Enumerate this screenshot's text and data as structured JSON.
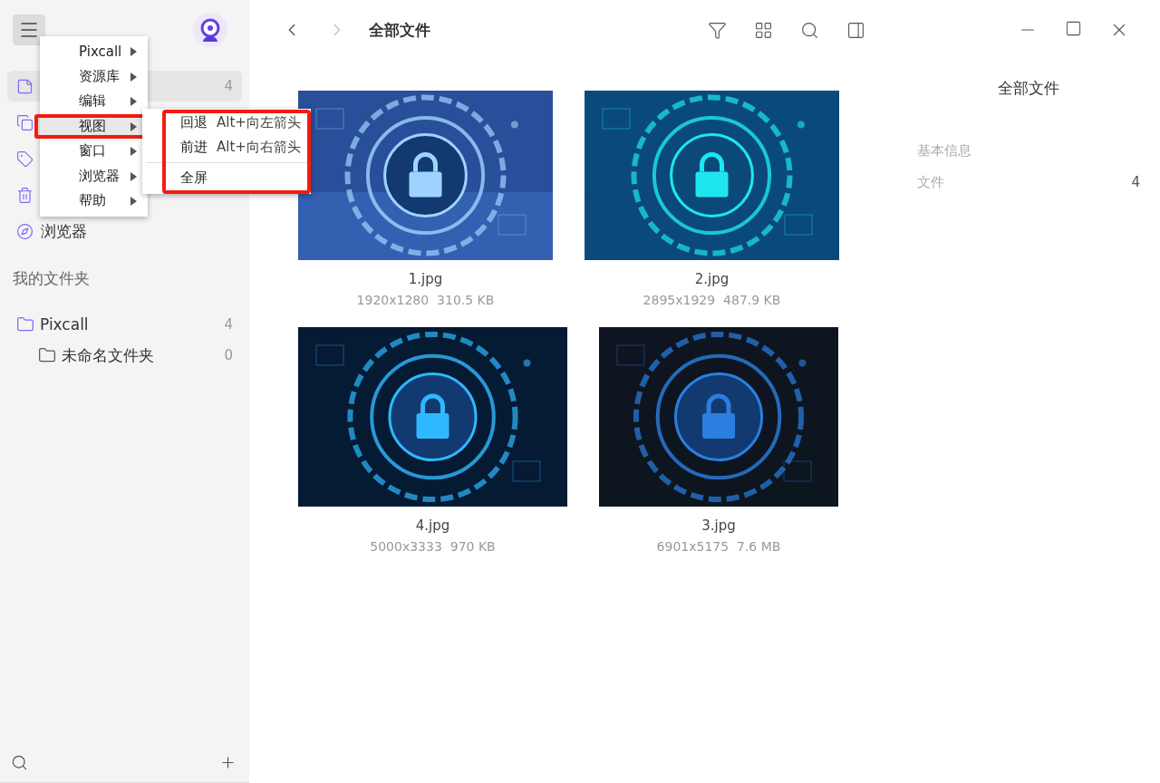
{
  "sidebar": {
    "nav": [
      {
        "count": "4",
        "selected": true
      },
      {
        "selected": false
      },
      {
        "selected": false
      },
      {
        "selected": false
      },
      {
        "label": "浏览器",
        "selected": false
      }
    ],
    "folders_heading": "我的文件夹",
    "folders": [
      {
        "name": "Pixcall",
        "count": "4",
        "children": [
          {
            "name": "未命名文件夹",
            "count": "0"
          }
        ]
      }
    ]
  },
  "menu": {
    "items": [
      {
        "label": "Pixcall",
        "highlighted": false
      },
      {
        "label": "资源库",
        "highlighted": false
      },
      {
        "label": "编辑",
        "highlighted": false
      },
      {
        "label": "视图",
        "highlighted": true
      },
      {
        "label": "窗口",
        "highlighted": false
      },
      {
        "label": "浏览器",
        "highlighted": false
      },
      {
        "label": "帮助",
        "highlighted": false
      }
    ],
    "submenu": {
      "highlighted": true,
      "items": [
        {
          "kind": "command",
          "label": "回退",
          "shortcut": "Alt+向左箭头"
        },
        {
          "kind": "command",
          "label": "前进",
          "shortcut": "Alt+向右箭头"
        },
        {
          "kind": "separator"
        },
        {
          "kind": "command",
          "label": "全屏"
        }
      ]
    }
  },
  "toolbar": {
    "title": "全部文件",
    "back_disabled": false,
    "forward_disabled": true
  },
  "gallery": {
    "rows": [
      [
        {
          "name": "1.jpg",
          "dimensions": "1920x1280",
          "size": "310.5 KB",
          "kind": "picture"
        },
        {
          "name": "2.jpg",
          "dimensions": "2895x1929",
          "size": "487.9 KB",
          "kind": "picture"
        }
      ],
      [
        {
          "name": "4.jpg",
          "dimensions": "5000x3333",
          "size": "970 KB",
          "kind": "picture"
        },
        {
          "name": "3.jpg",
          "dimensions": "6901x5175",
          "size": "7.6 MB",
          "kind": "picture"
        }
      ]
    ]
  },
  "info_panel": {
    "title": "全部文件",
    "section": "基本信息",
    "rows": [
      {
        "label": "文件",
        "value": "4"
      }
    ]
  }
}
